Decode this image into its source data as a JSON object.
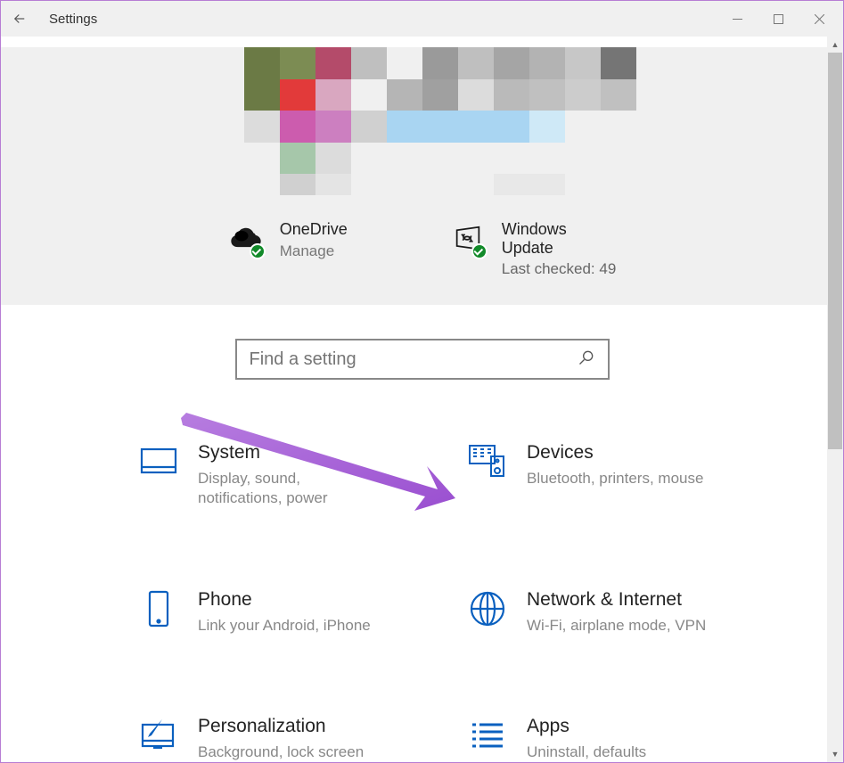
{
  "window": {
    "title": "Settings"
  },
  "account_tiles": {
    "onedrive": {
      "title": "OneDrive",
      "subtitle": "Manage"
    },
    "windows_update": {
      "title": "Windows Update",
      "subtitle": "Last checked: 49"
    }
  },
  "search": {
    "placeholder": "Find a setting"
  },
  "categories": [
    {
      "key": "system",
      "title": "System",
      "subtitle": "Display, sound, notifications, power"
    },
    {
      "key": "devices",
      "title": "Devices",
      "subtitle": "Bluetooth, printers, mouse"
    },
    {
      "key": "phone",
      "title": "Phone",
      "subtitle": "Link your Android, iPhone"
    },
    {
      "key": "network",
      "title": "Network & Internet",
      "subtitle": "Wi-Fi, airplane mode, VPN"
    },
    {
      "key": "personalization",
      "title": "Personalization",
      "subtitle": "Background, lock screen"
    },
    {
      "key": "apps",
      "title": "Apps",
      "subtitle": "Uninstall, defaults"
    }
  ],
  "pixelated_colors": [
    "#f0f0f0",
    "#6b7a45",
    "#7c8c53",
    "#b44b6a",
    "#bfbfbf",
    "#f0f0f0",
    "#9a9a9a",
    "#bfbfbf",
    "#a5a5a5",
    "#b3b3b3",
    "#c7c7c7",
    "#757575",
    "#f0f0f0",
    "#6b7a45",
    "#e23a3a",
    "#d9a7c0",
    "#f0f0f0",
    "#b5b5b5",
    "#a0a0a0",
    "#dcdcdc",
    "#bababa",
    "#c0c0c0",
    "#cccccc",
    "#c0c0c0",
    "#f0f0f0",
    "#dcdcdc",
    "#cc5cae",
    "#cc7fc0",
    "#d0d0d0",
    "#a9d5f2",
    "#a9d5f2",
    "#a9d5f2",
    "#a9d5f2",
    "#cfe9f7",
    "#f0f0f0",
    "#f0f0f0",
    "#f0f0f0",
    "#f0f0f0",
    "#a6c7aa",
    "#dcdcdc",
    "#f0f0f0",
    "#f0f0f0",
    "#f0f0f0",
    "#f0f0f0",
    "#f0f0f0",
    "#f0f0f0",
    "#f0f0f0",
    "#f0f0f0"
  ]
}
